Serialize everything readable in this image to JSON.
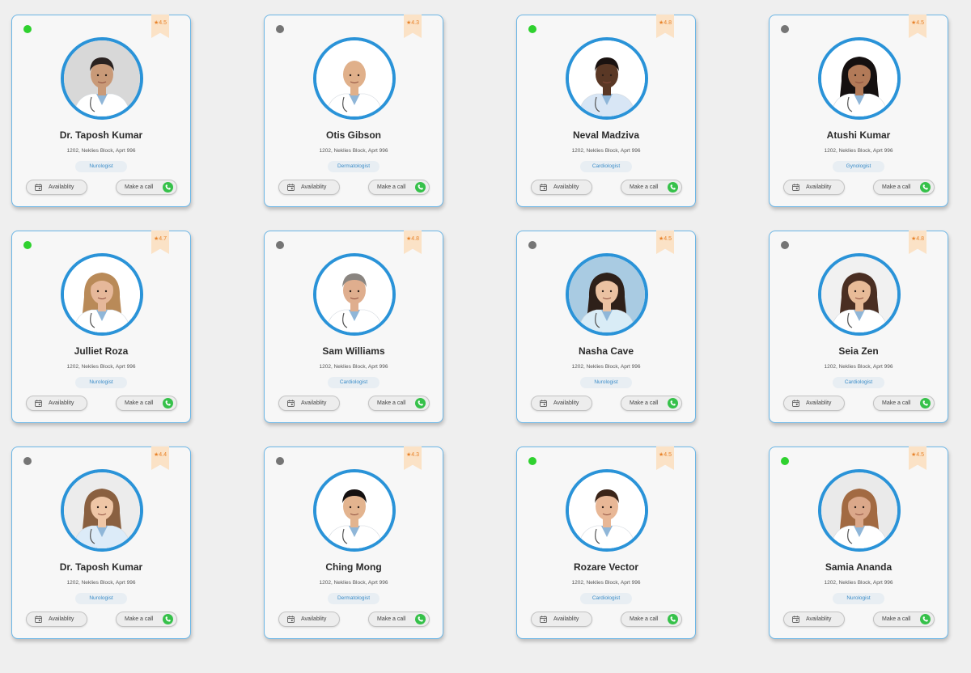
{
  "colors": {
    "accent": "#2a93d8",
    "online": "#2fd12f",
    "offline": "#757575",
    "rating_ribbon": "#fbe2c6",
    "call_green": "#36c14a"
  },
  "labels": {
    "availability": "Availablity",
    "call": "Make a call"
  },
  "doctors": [
    {
      "name": "Dr. Taposh Kumar",
      "address": "1202, Neklies Block, Aprt 996",
      "specialty": "Nurologist",
      "rating": "4.5",
      "status": "online",
      "skin": "#c99a78",
      "hair": "#2a2220",
      "coat": "#ffffff",
      "bg": "#d8d8d8",
      "hair_style": "short"
    },
    {
      "name": "Otis Gibson",
      "address": "1202, Neklies Block, Aprt 996",
      "specialty": "Dermatologist",
      "rating": "4.3",
      "status": "offline",
      "skin": "#e0b08a",
      "hair": "#d8a882",
      "coat": "#ffffff",
      "bg": "#ffffff",
      "hair_style": "bald"
    },
    {
      "name": "Neval Madziva",
      "address": "1202, Neklies Block, Aprt 996",
      "specialty": "Cardiologist",
      "rating": "4.8",
      "status": "online",
      "skin": "#5a3825",
      "hair": "#1a1210",
      "coat": "#d8e6f5",
      "bg": "#ffffff",
      "hair_style": "short"
    },
    {
      "name": "Atushi Kumar",
      "address": "1202, Neklies Block, Aprt 996",
      "specialty": "Gynologist",
      "rating": "4.5",
      "status": "offline",
      "skin": "#b27a58",
      "hair": "#151010",
      "coat": "#ffffff",
      "bg": "#ffffff",
      "hair_style": "long"
    },
    {
      "name": "Julliet Roza",
      "address": "1202, Neklies Block, Aprt 996",
      "specialty": "Nurologist",
      "rating": "4.7",
      "status": "online",
      "skin": "#e6b89a",
      "hair": "#b98a58",
      "coat": "#ffffff",
      "bg": "#ffffff",
      "hair_style": "long"
    },
    {
      "name": "Sam Williams",
      "address": "1202, Neklies Block, Aprt 996",
      "specialty": "Cardiologist",
      "rating": "4.8",
      "status": "offline",
      "skin": "#dfae8e",
      "hair": "#8a8580",
      "coat": "#ffffff",
      "bg": "#ffffff",
      "hair_style": "short"
    },
    {
      "name": "Nasha Cave",
      "address": "1202, Neklies Block, Aprt 996",
      "specialty": "Nurologist",
      "rating": "4.5",
      "status": "offline",
      "skin": "#ebc2a2",
      "hair": "#2e2019",
      "coat": "#d9ecf6",
      "bg": "#a9cbe2",
      "hair_style": "long"
    },
    {
      "name": "Seia Zen",
      "address": "1202, Neklies Block, Aprt 996",
      "specialty": "Cardiologist",
      "rating": "4.8",
      "status": "offline",
      "skin": "#e8bb98",
      "hair": "#4a2e22",
      "coat": "#ffffff",
      "bg": "#f1f1f1",
      "hair_style": "long"
    },
    {
      "name": "Dr. Taposh Kumar",
      "address": "1202, Neklies Block, Aprt 996",
      "specialty": "Nurologist",
      "rating": "4.4",
      "status": "offline",
      "skin": "#efc6a6",
      "hair": "#8a6040",
      "coat": "#dcebf8",
      "bg": "#ececec",
      "hair_style": "long"
    },
    {
      "name": "Ching Mong",
      "address": "1202, Neklies Block, Aprt 996",
      "specialty": "Dermatologist",
      "rating": "4.3",
      "status": "offline",
      "skin": "#e3b48f",
      "hair": "#141010",
      "coat": "#ffffff",
      "bg": "#ffffff",
      "hair_style": "short"
    },
    {
      "name": "Rozare Vector",
      "address": "1202, Neklies Block, Aprt 996",
      "specialty": "Cardiologist",
      "rating": "4.5",
      "status": "online",
      "skin": "#e8b796",
      "hair": "#3a2418",
      "coat": "#ffffff",
      "bg": "#ffffff",
      "hair_style": "short"
    },
    {
      "name": "Samia Ananda",
      "address": "1202, Neklies Block, Aprt 996",
      "specialty": "Nurologist",
      "rating": "4.5",
      "status": "online",
      "skin": "#dba88a",
      "hair": "#a26a42",
      "coat": "#ffffff",
      "bg": "#eaeaea",
      "hair_style": "long"
    }
  ]
}
